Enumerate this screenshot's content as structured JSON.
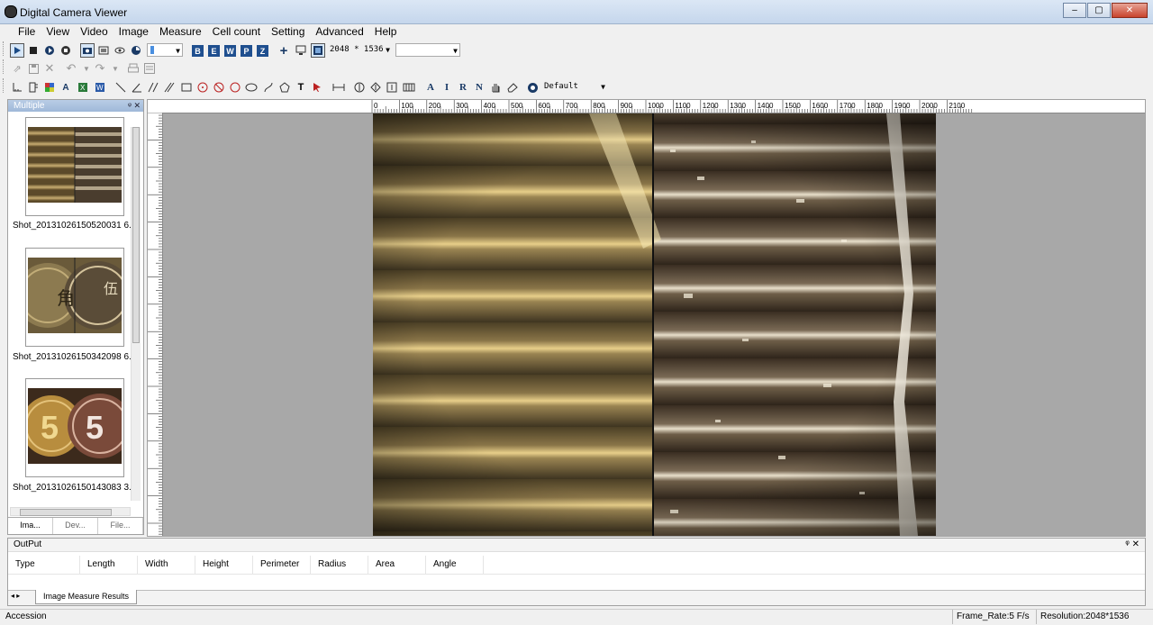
{
  "window": {
    "title": "Digital Camera Viewer"
  },
  "menu": [
    "File",
    "View",
    "Video",
    "Image",
    "Measure",
    "Cell count",
    "Setting",
    "Advanced",
    "Help"
  ],
  "toolbar": {
    "resolution_combo": "2048 * 1536",
    "letters": [
      "B",
      "E",
      "W",
      "P",
      "Z"
    ],
    "text_tools": [
      "A",
      "I",
      "R",
      "N"
    ],
    "style_combo": "Default"
  },
  "sidebar": {
    "title": "Multiple",
    "thumbnails": [
      {
        "caption": "Shot_20131026150520031 6.b"
      },
      {
        "caption": "Shot_20131026150342098 6.b"
      },
      {
        "caption": "Shot_20131026150143083 3.b"
      }
    ],
    "tabs": [
      "Ima...",
      "Dev...",
      "File..."
    ]
  },
  "ruler": {
    "h_labels": [
      "0",
      "100",
      "200",
      "300",
      "400",
      "500",
      "600",
      "700",
      "800",
      "900",
      "1000",
      "1100",
      "1200",
      "1300",
      "1400",
      "1500",
      "1600",
      "1700",
      "1800",
      "1900",
      "2000",
      "2100"
    ],
    "v_labels": [
      "100",
      "200",
      "300",
      "400",
      "500",
      "600",
      "700",
      "800",
      "900",
      "1000",
      "1100",
      "1200",
      "1300",
      "1400",
      "1500"
    ]
  },
  "output": {
    "title": "OutPut",
    "columns": [
      "Type",
      "Length",
      "Width",
      "Height",
      "Perimeter",
      "Radius",
      "Area",
      "Angle"
    ],
    "tab": "Image Measure Results"
  },
  "status": {
    "left": "Accession",
    "frame_rate": "Frame_Rate:5 F/s",
    "resolution": "Resolution:2048*1536"
  }
}
